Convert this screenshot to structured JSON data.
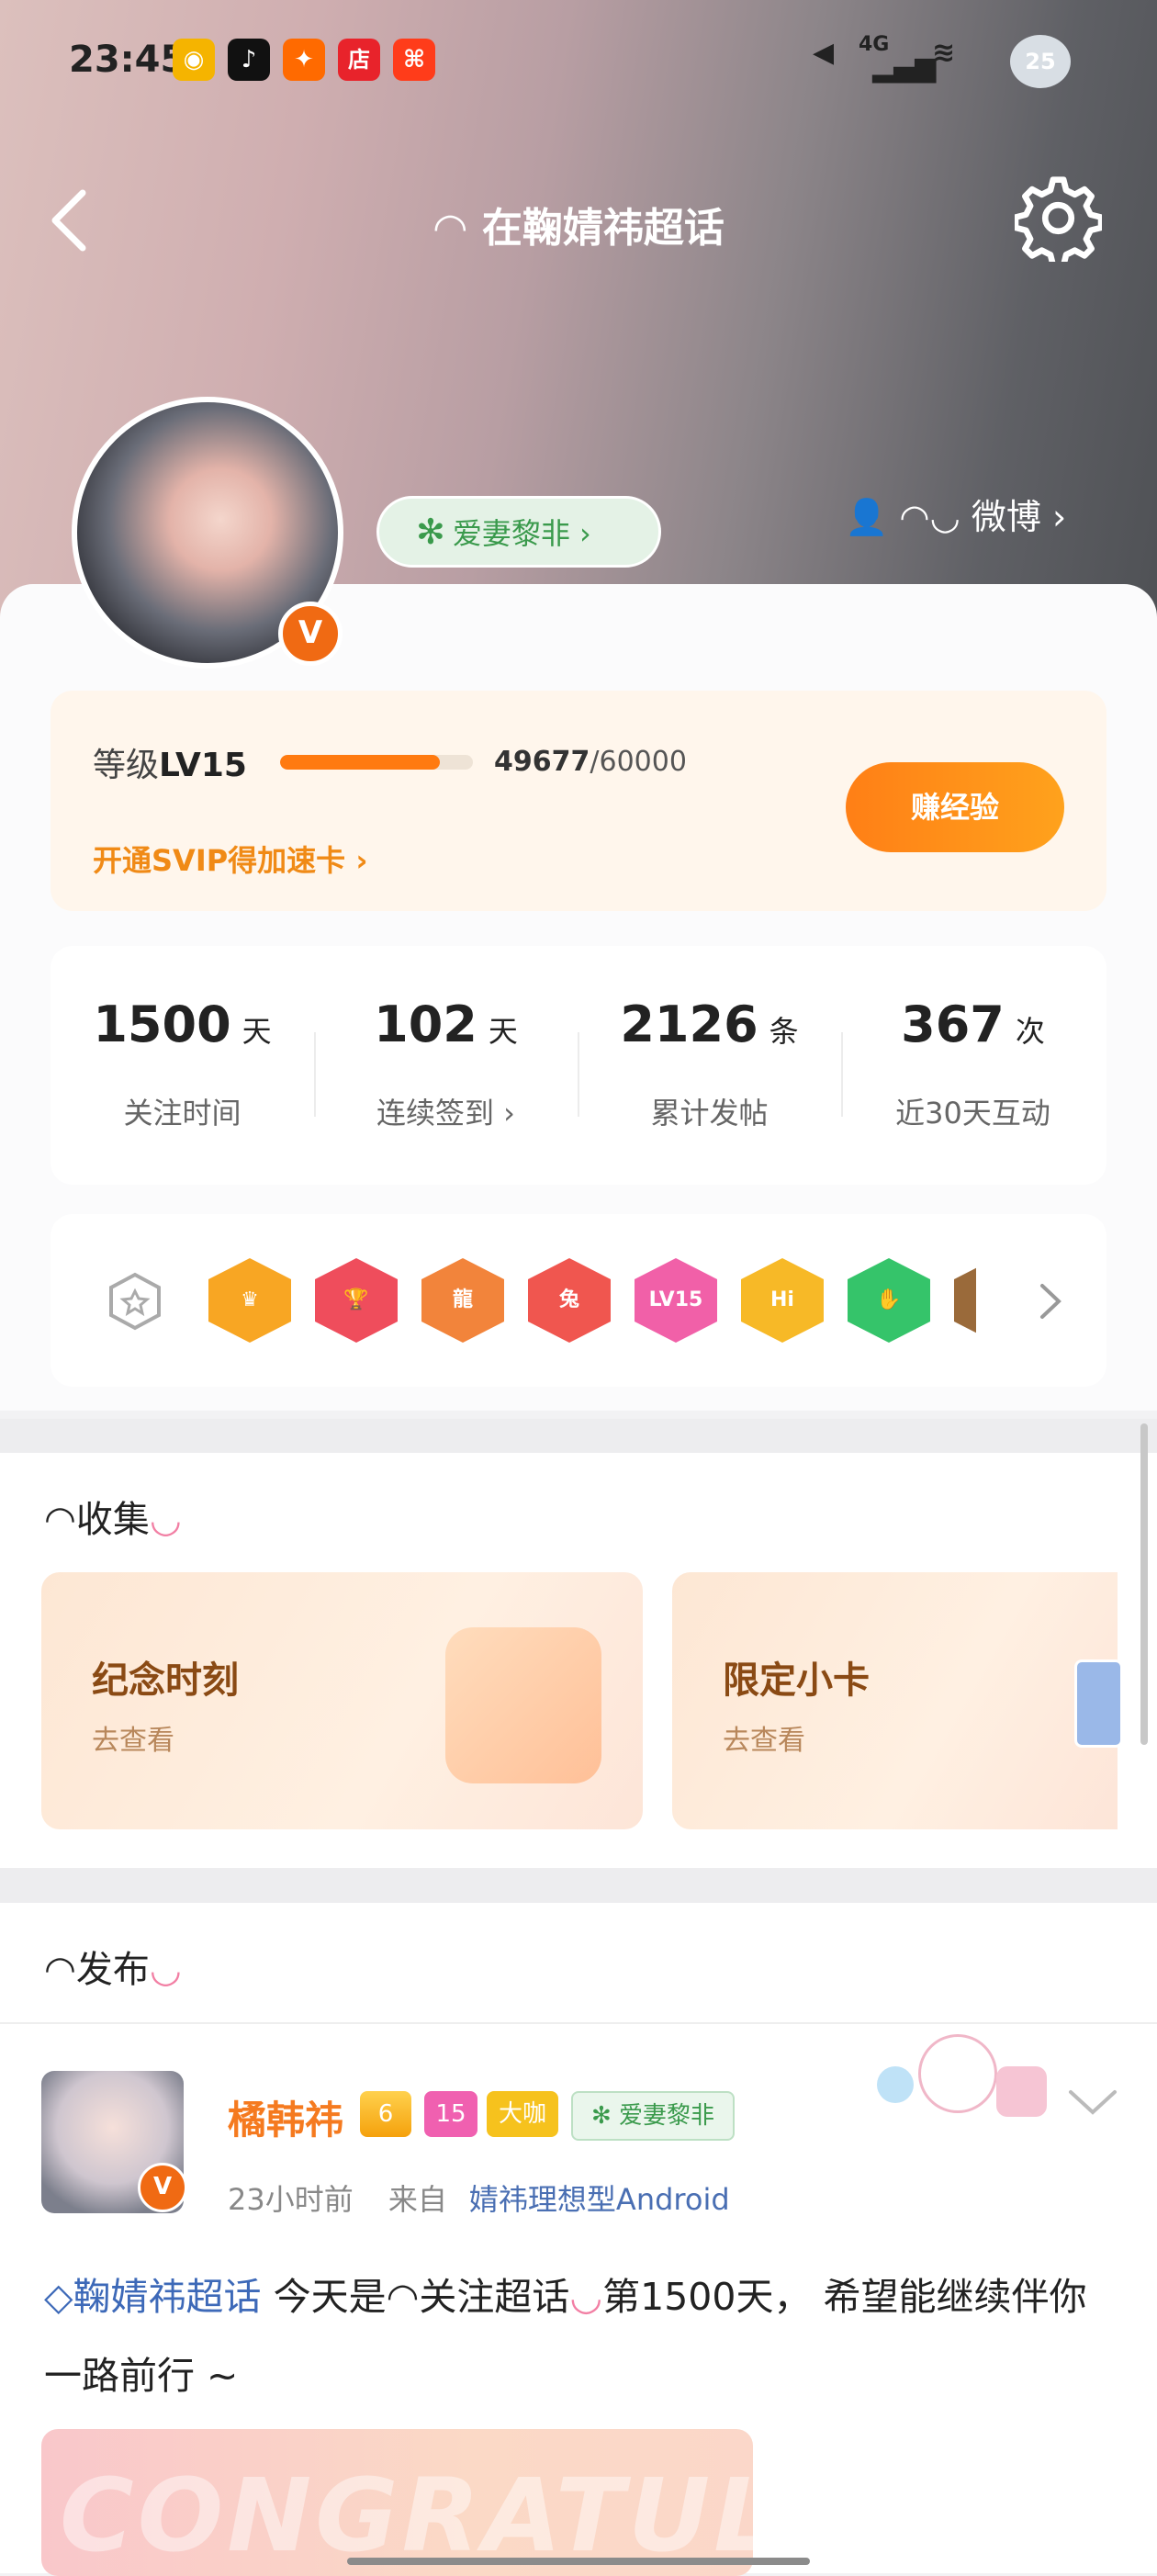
{
  "status_bar": {
    "time": "23:45",
    "apps": [
      {
        "icon": "weibo-icon",
        "glyph": "◉",
        "color": "#f5b400"
      },
      {
        "icon": "douyin-icon",
        "glyph": "♪",
        "color": "#111111"
      },
      {
        "icon": "app-icon",
        "glyph": "✦",
        "color": "#ff6a00"
      },
      {
        "icon": "store-icon",
        "glyph": "店",
        "color": "#e8232b"
      },
      {
        "icon": "meituan-icon",
        "glyph": "⌘",
        "color": "#ff3c1a"
      }
    ],
    "network": "4G",
    "battery": "25"
  },
  "header": {
    "title": "在鞠婧祎超话",
    "fan_name": "爱妻黎非",
    "weibo_link": "微博"
  },
  "level": {
    "label_prefix": "等级",
    "level": "LV15",
    "exp_current": "49677",
    "exp_total": "/60000",
    "progress": 0.828,
    "svip_text": "开通SVIP得加速卡",
    "earn_button": "赚经验"
  },
  "stats": [
    {
      "value": "1500",
      "unit": "天",
      "label": "关注时间"
    },
    {
      "value": "102",
      "unit": "天",
      "label": "连续签到 ›"
    },
    {
      "value": "2126",
      "unit": "条",
      "label": "累计发帖"
    },
    {
      "value": "367",
      "unit": "次",
      "label": "近30天互动"
    }
  ],
  "badges": [
    {
      "icon": "crown-medal-icon",
      "text": "♛",
      "color": "#f8a623"
    },
    {
      "icon": "trophy-medal-icon",
      "text": "🏆",
      "color": "#ef4d5c"
    },
    {
      "icon": "dragon-medal-icon",
      "text": "龍",
      "color": "#f2843b"
    },
    {
      "icon": "rabbit-medal-icon",
      "text": "兔",
      "color": "#f0564f"
    },
    {
      "icon": "lv15-medal-icon",
      "text": "LV15",
      "color": "#f160a8"
    },
    {
      "icon": "hi-medal-icon",
      "text": "Hi",
      "color": "#f7b927"
    },
    {
      "icon": "hand-medal-icon",
      "text": "✋",
      "color": "#35c46a"
    }
  ],
  "collect": {
    "title": "收集",
    "cards": [
      {
        "title": "纪念时刻",
        "sub": "去查看"
      },
      {
        "title": "限定小卡",
        "sub": "去查看"
      }
    ]
  },
  "publish": {
    "title": "发布",
    "user": "橘韩祎",
    "tags": [
      "6",
      "15",
      "大咖",
      "爱妻黎非"
    ],
    "time": "23小时前",
    "from": "来自",
    "source": "婧祎理想型Android",
    "topic": "鞠婧祎超话",
    "text_1": " 今天是",
    "text_2": "关注超话",
    "text_3": "第1500天",
    "text_4": "， 希望能继续伴你一",
    "text_5": "路前行 ~",
    "photo_word": "CONGRATULATE"
  }
}
